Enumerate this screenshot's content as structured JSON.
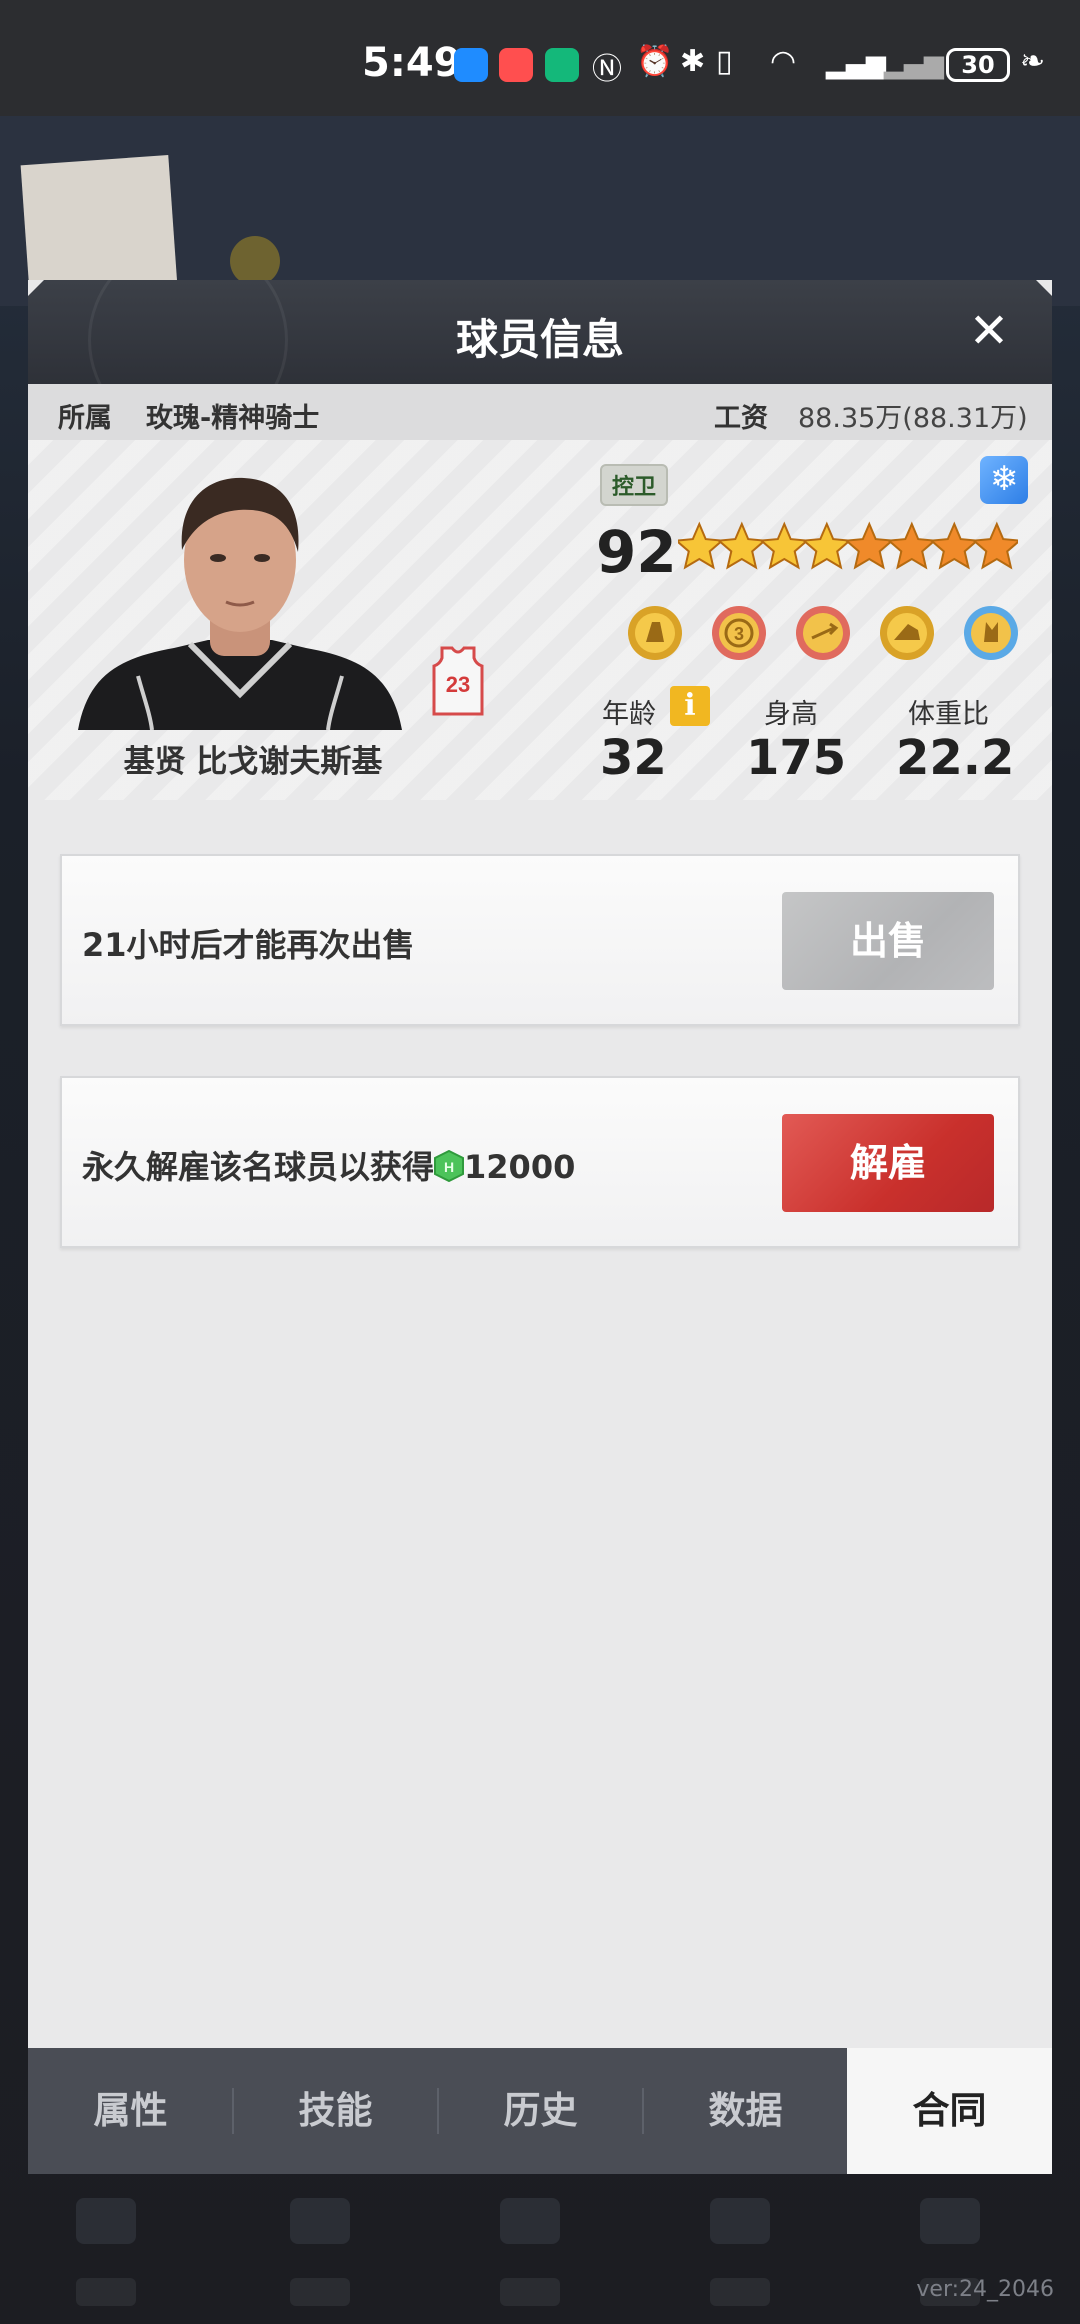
{
  "status_bar": {
    "time": "5:49",
    "battery": "30",
    "icons": [
      "chat-app-icon",
      "taobao-app-icon",
      "robot-app-icon",
      "nfc-icon",
      "alarm-icon",
      "bluetooth-icon",
      "vibrate-icon",
      "wifi-icon",
      "5g-signal-icon",
      "no-signal-icon",
      "leaf-icon"
    ]
  },
  "background": {
    "version": "ver:24_2046"
  },
  "dialog": {
    "title": "球员信息",
    "info_bar": {
      "team_label": "所属",
      "team_value": "玫瑰-精神骑士",
      "salary_label": "工资",
      "salary_value": "88.35万(88.31万)"
    },
    "player": {
      "name": "基贤 比戈谢夫斯基",
      "jersey_number": "23",
      "position": "控卫",
      "rating": "92",
      "stars_total": 8,
      "stars_gold": 4,
      "badges": [
        "badge-defense-icon",
        "badge-three-point-icon",
        "badge-pass-icon",
        "badge-shoe-icon",
        "badge-rebound-icon"
      ],
      "stats": {
        "age_label": "年龄",
        "age_value": "32",
        "height_label": "身高",
        "height_value": "175",
        "weight_label": "体重比",
        "weight_value": "22.2"
      }
    },
    "sell_card": {
      "text": "21小时后才能再次出售",
      "button": "出售"
    },
    "release_card": {
      "text": "永久解雇该名球员以获得",
      "amount": "12000",
      "button": "解雇"
    },
    "tabs": [
      "属性",
      "技能",
      "历史",
      "数据",
      "合同"
    ],
    "active_tab": 4
  }
}
